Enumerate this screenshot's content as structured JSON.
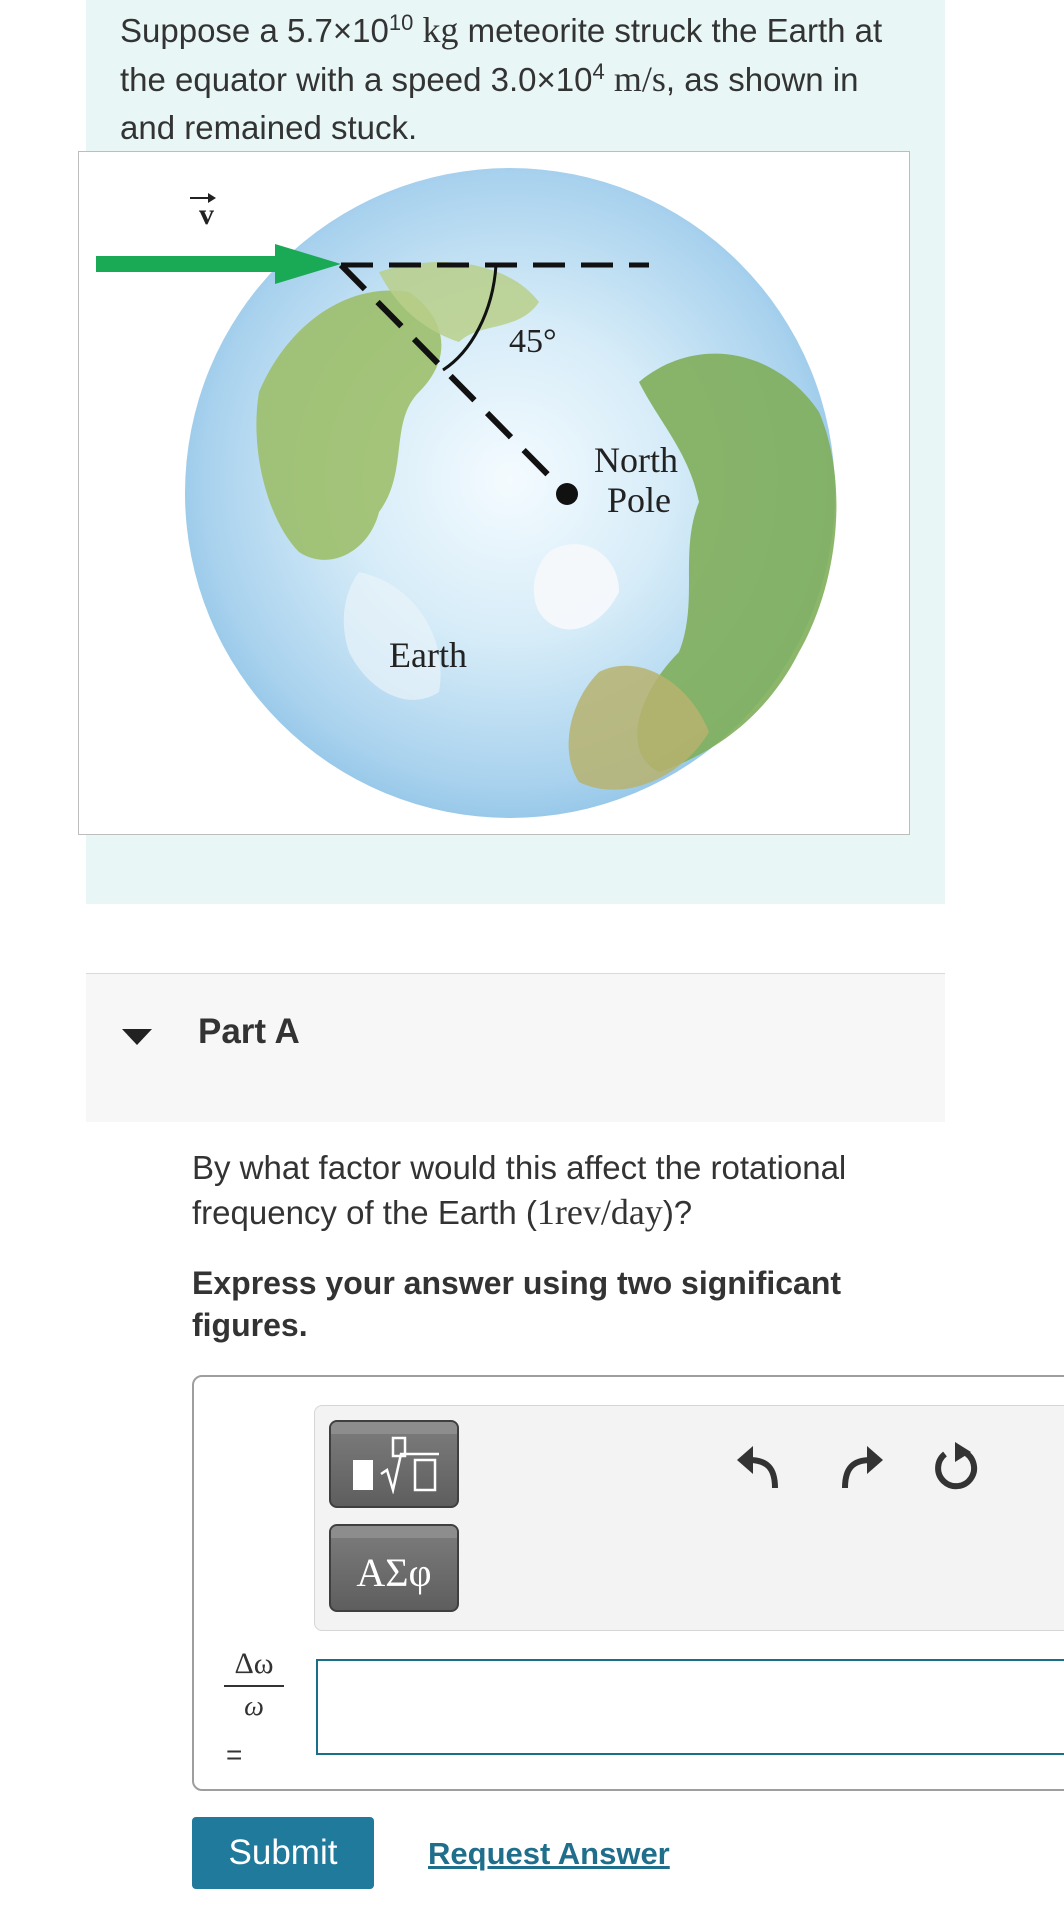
{
  "intro": {
    "text_1": "Suppose a 5.7×10",
    "exp_1": "10",
    "unit_1": "kg",
    "text_2": " meteorite struck the Earth at the equator with a speed 3.0×10",
    "exp_2": "4",
    "unit_2": "m/s",
    "text_3": ", as shown in and remained stuck."
  },
  "figure": {
    "velocity_label": "v",
    "angle_label": "45°",
    "north_label": "North",
    "pole_label": "Pole",
    "earth_label": "Earth",
    "arrow_color": "#1aaa55"
  },
  "part": {
    "title": "Part A"
  },
  "question": {
    "text_1": "By what factor would this affect the rotational frequency of the Earth (",
    "expr": "1rev/day",
    "text_2": ")?"
  },
  "instruction": "Express your answer using two significant figures.",
  "answer": {
    "lhs_numerator": "Δω",
    "lhs_denominator": "ω",
    "equals": "=",
    "value": "",
    "greek_button": "ΑΣφ"
  },
  "icons": {
    "template": "fraction-sqrt-icon",
    "undo": "undo-icon",
    "redo": "redo-icon",
    "reset": "reset-icon"
  },
  "buttons": {
    "submit": "Submit",
    "request_answer": "Request Answer"
  }
}
